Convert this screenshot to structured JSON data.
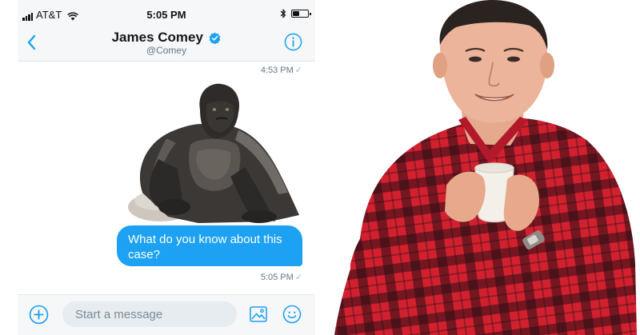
{
  "status_bar": {
    "carrier": "AT&T",
    "time": "5:05 PM"
  },
  "header": {
    "name": "James Comey",
    "handle": "@Comey"
  },
  "conversation": {
    "messages": [
      {
        "type": "image",
        "description_icon": "gorilla-photo",
        "timestamp": "4:53 PM"
      },
      {
        "type": "text",
        "text": "What do you know about this case?",
        "timestamp": "5:05 PM"
      }
    ],
    "read_mark": "✓"
  },
  "composer": {
    "placeholder": "Start a message"
  },
  "colors": {
    "accent": "#1da1f2",
    "bubble_text": "#ffffff",
    "secondary_text": "#657786",
    "plaid_red": "#d3202f",
    "plaid_black": "#1a1114"
  }
}
